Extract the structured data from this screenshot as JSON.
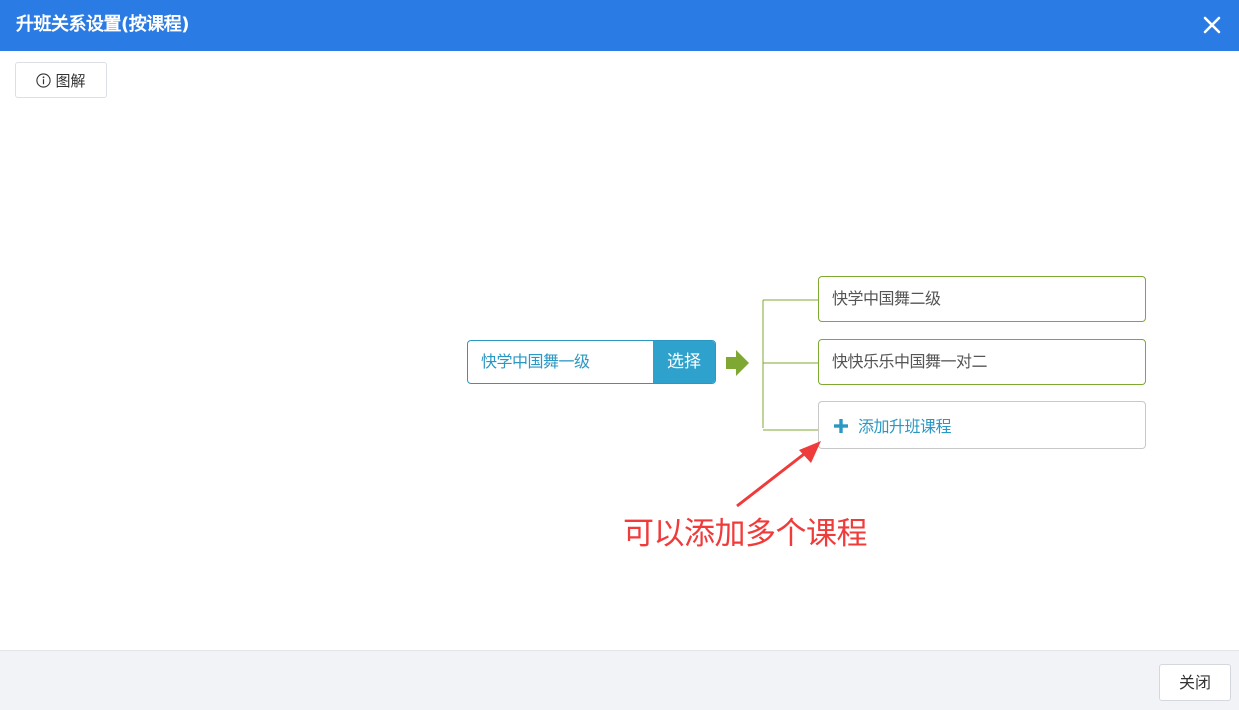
{
  "dialog": {
    "title": "升班关系设置(按课程)",
    "close_icon": "close-icon"
  },
  "toolbar": {
    "diagram_button_label": "图解",
    "diagram_icon": "info-icon"
  },
  "source_course": {
    "name": "快学中国舞一级",
    "select_label": "选择"
  },
  "target_courses": [
    {
      "name": "快学中国舞二级"
    },
    {
      "name": "快快乐乐中国舞一对二"
    }
  ],
  "add_course": {
    "label": "添加升班课程",
    "icon": "plus-icon"
  },
  "annotation": {
    "text": "可以添加多个课程"
  },
  "footer": {
    "close_label": "关闭"
  },
  "colors": {
    "titlebar": "#2b7be4",
    "accent_blue": "#2b98c4",
    "select_button": "#2ea2cc",
    "target_border": "#7ea832",
    "arrow_green": "#7ea832",
    "annotation_red": "#f03b3b",
    "footer_bg": "#f2f3f7"
  }
}
